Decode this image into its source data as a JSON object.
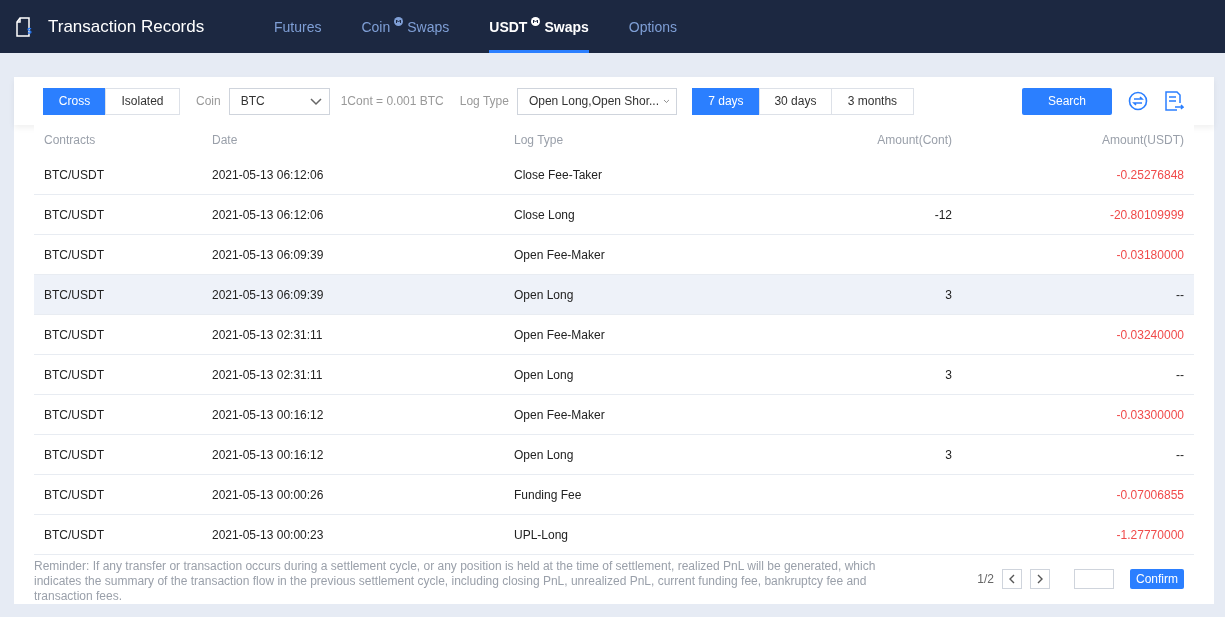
{
  "header": {
    "title": "Transaction Records",
    "tabs": [
      {
        "label": "Futures",
        "selected": false
      },
      {
        "label": "Coin",
        "suffix": "Swaps",
        "selected": false
      },
      {
        "label": "USDT",
        "suffix": "Swaps",
        "selected": true
      },
      {
        "label": "Options",
        "selected": false
      }
    ]
  },
  "filters": {
    "margin_modes": [
      {
        "label": "Cross",
        "selected": true
      },
      {
        "label": "Isolated",
        "selected": false
      }
    ],
    "coin_label": "Coin",
    "coin_value": "BTC",
    "contract_note": "1Cont = 0.001 BTC",
    "log_type_label": "Log Type",
    "log_type_value": "Open Long,Open Shor...",
    "periods": [
      {
        "label": "7 days",
        "selected": true
      },
      {
        "label": "30 days",
        "selected": false
      },
      {
        "label": "3 months",
        "selected": false
      }
    ],
    "search_button": "Search"
  },
  "table": {
    "columns": [
      "Contracts",
      "Date",
      "Log Type",
      "Amount(Cont)",
      "Amount(USDT)"
    ],
    "rows": [
      {
        "contract": "BTC/USDT",
        "date": "2021-05-13 06:12:06",
        "log_type": "Close Fee-Taker",
        "amount_cont": "",
        "amount_usdt": "-0.25276848",
        "kind": "debit",
        "selected": false
      },
      {
        "contract": "BTC/USDT",
        "date": "2021-05-13 06:12:06",
        "log_type": "Close Long",
        "amount_cont": "-12",
        "amount_usdt": "-20.80109999",
        "kind": "debit",
        "selected": false
      },
      {
        "contract": "BTC/USDT",
        "date": "2021-05-13 06:09:39",
        "log_type": "Open Fee-Maker",
        "amount_cont": "",
        "amount_usdt": "-0.03180000",
        "kind": "debit",
        "selected": false
      },
      {
        "contract": "BTC/USDT",
        "date": "2021-05-13 06:09:39",
        "log_type": "Open Long",
        "amount_cont": "3",
        "amount_usdt": "--",
        "kind": "none",
        "selected": true
      },
      {
        "contract": "BTC/USDT",
        "date": "2021-05-13 02:31:11",
        "log_type": "Open Fee-Maker",
        "amount_cont": "",
        "amount_usdt": "-0.03240000",
        "kind": "debit",
        "selected": false
      },
      {
        "contract": "BTC/USDT",
        "date": "2021-05-13 02:31:11",
        "log_type": "Open Long",
        "amount_cont": "3",
        "amount_usdt": "--",
        "kind": "none",
        "selected": false
      },
      {
        "contract": "BTC/USDT",
        "date": "2021-05-13 00:16:12",
        "log_type": "Open Fee-Maker",
        "amount_cont": "",
        "amount_usdt": "-0.03300000",
        "kind": "debit",
        "selected": false
      },
      {
        "contract": "BTC/USDT",
        "date": "2021-05-13 00:16:12",
        "log_type": "Open Long",
        "amount_cont": "3",
        "amount_usdt": "--",
        "kind": "none",
        "selected": false
      },
      {
        "contract": "BTC/USDT",
        "date": "2021-05-13 00:00:26",
        "log_type": "Funding Fee",
        "amount_cont": "",
        "amount_usdt": "-0.07006855",
        "kind": "debit",
        "selected": false
      },
      {
        "contract": "BTC/USDT",
        "date": "2021-05-13 00:00:23",
        "log_type": "UPL-Long",
        "amount_cont": "",
        "amount_usdt": "-1.27770000",
        "kind": "debit",
        "selected": false
      }
    ]
  },
  "footer": {
    "reminder": "Reminder: If any transfer or transaction occurs during a settlement cycle, or any position is held at the time of settlement, realized PnL will be generated, which indicates the summary of the transaction flow in the previous settlement cycle, including closing PnL, unrealized PnL, current funding fee, bankruptcy fee and transaction fees.",
    "page": "1/2",
    "confirm_button": "Confirm"
  }
}
